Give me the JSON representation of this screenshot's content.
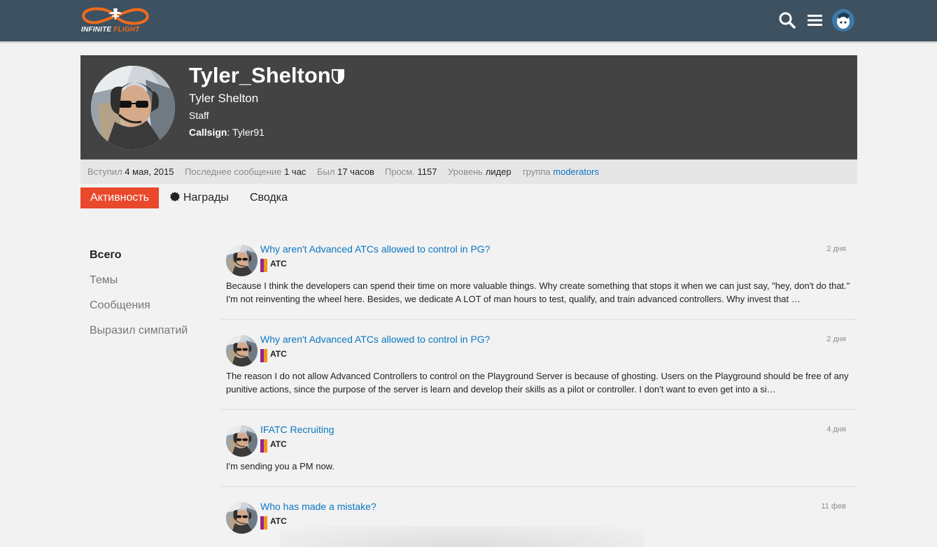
{
  "header": {
    "logo": {
      "word1": "INFINITE",
      "word2": "FLIGHT"
    },
    "icons": [
      "search-icon",
      "hamburger-menu-icon",
      "user-avatar"
    ],
    "bg_color": "#3e5161",
    "accent_color": "#f26a1b"
  },
  "profile": {
    "username": "Tyler_Shelton",
    "full_name": "Tyler Shelton",
    "title": "Staff",
    "callsign_label": "Callsign",
    "callsign_value": ": Tyler91"
  },
  "stats": {
    "joined_label": "Вступил",
    "joined_value": "4 мая, 2015",
    "last_post_label": "Последнее сообщение",
    "last_post_value": "1 час",
    "seen_label": "Был",
    "seen_value": "17 часов",
    "views_label": "Просм.",
    "views_value": "1157",
    "trust_label": "Уровень",
    "trust_value": "лидер",
    "group_label": "группа",
    "group_value": "moderators"
  },
  "tabs": {
    "activity": "Активность",
    "awards": "Награды",
    "summary": "Сводка"
  },
  "filters": [
    "Всего",
    "Темы",
    "Сообщения",
    "Выразил симпатий"
  ],
  "category_colors": [
    "#92278f",
    "#f7941d"
  ],
  "items": [
    {
      "title": "Why aren't Advanced ATCs allowed to control in PG?",
      "category": "ATC",
      "date": "2 дня",
      "excerpt": "Because I think the developers can spend their time on more valuable things. Why create something that stops it when we can just say, \"hey, don't do that.\" I'm not reinventing the wheel here. Besides, we dedicate A LOT of man hours to test, qualify, and train advanced controllers. Why invest that …"
    },
    {
      "title": "Why aren't Advanced ATCs allowed to control in PG?",
      "category": "ATC",
      "date": "2 дня",
      "excerpt": "The reason I do not allow Advanced Controllers to control on the Playground Server is because of ghosting. Users on the Playground should be free of any punitive actions, since the purpose of the server is learn and develop their skills as a pilot or controller. I don't want to even get into a si…"
    },
    {
      "title": "IFATC Recruiting",
      "category": "ATC",
      "date": "4 дня",
      "excerpt": "I'm sending you a PM now."
    },
    {
      "title": "Who has made a mistake?",
      "category": "ATC",
      "date": "11 фев",
      "excerpt": ""
    }
  ]
}
